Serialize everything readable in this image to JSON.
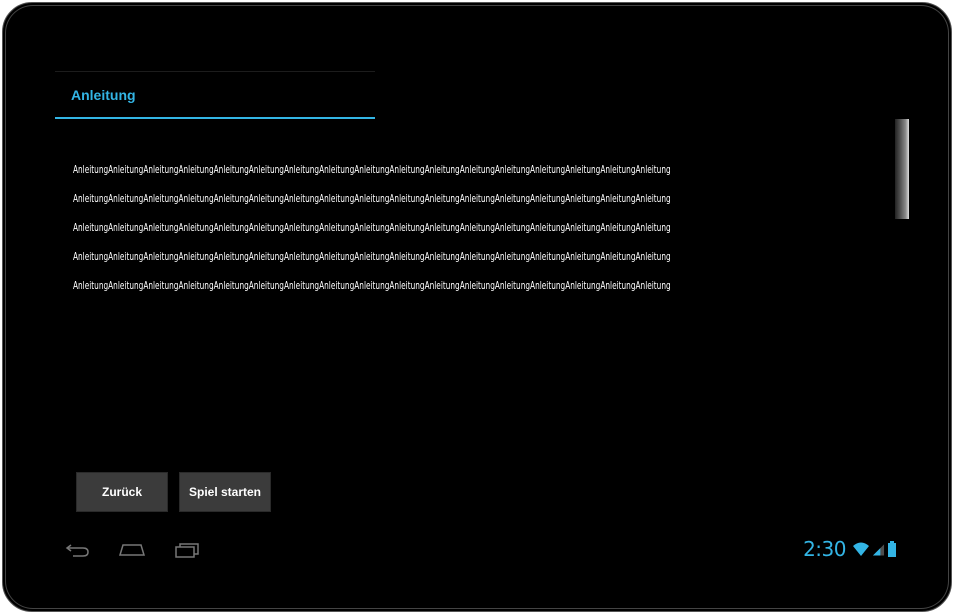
{
  "dialog": {
    "title": "Anleitung",
    "content_lines": [
      "AnleitungAnleitungAnleitungAnleitungAnleitungAnleitungAnleitungAnleitungAnleitungAnleitungAnleitungAnleitungAnleitungAnleitungAnleitungAnleitungAnleitung",
      "AnleitungAnleitungAnleitungAnleitungAnleitungAnleitungAnleitungAnleitungAnleitungAnleitungAnleitungAnleitungAnleitungAnleitungAnleitungAnleitungAnleitung",
      "AnleitungAnleitungAnleitungAnleitungAnleitungAnleitungAnleitungAnleitungAnleitungAnleitungAnleitungAnleitungAnleitungAnleitungAnleitungAnleitungAnleitung",
      "AnleitungAnleitungAnleitungAnleitungAnleitungAnleitungAnleitungAnleitungAnleitungAnleitungAnleitungAnleitungAnleitungAnleitungAnleitungAnleitungAnleitung",
      "AnleitungAnleitungAnleitungAnleitungAnleitungAnleitungAnleitungAnleitungAnleitungAnleitungAnleitungAnleitungAnleitungAnleitungAnleitungAnleitungAnleitung"
    ]
  },
  "buttons": {
    "back_label": "Zurück",
    "start_label": "Spiel starten"
  },
  "navbar": {
    "back_icon": "back-arrow-icon",
    "home_icon": "home-icon",
    "recent_icon": "recent-apps-icon"
  },
  "status_bar": {
    "time": "2:30",
    "wifi_icon": "wifi-icon",
    "signal_icon": "signal-icon",
    "battery_icon": "battery-icon"
  },
  "colors": {
    "accent": "#33b5e5",
    "background": "#000000",
    "button": "#3b3b3b",
    "text": "#ffffff"
  }
}
